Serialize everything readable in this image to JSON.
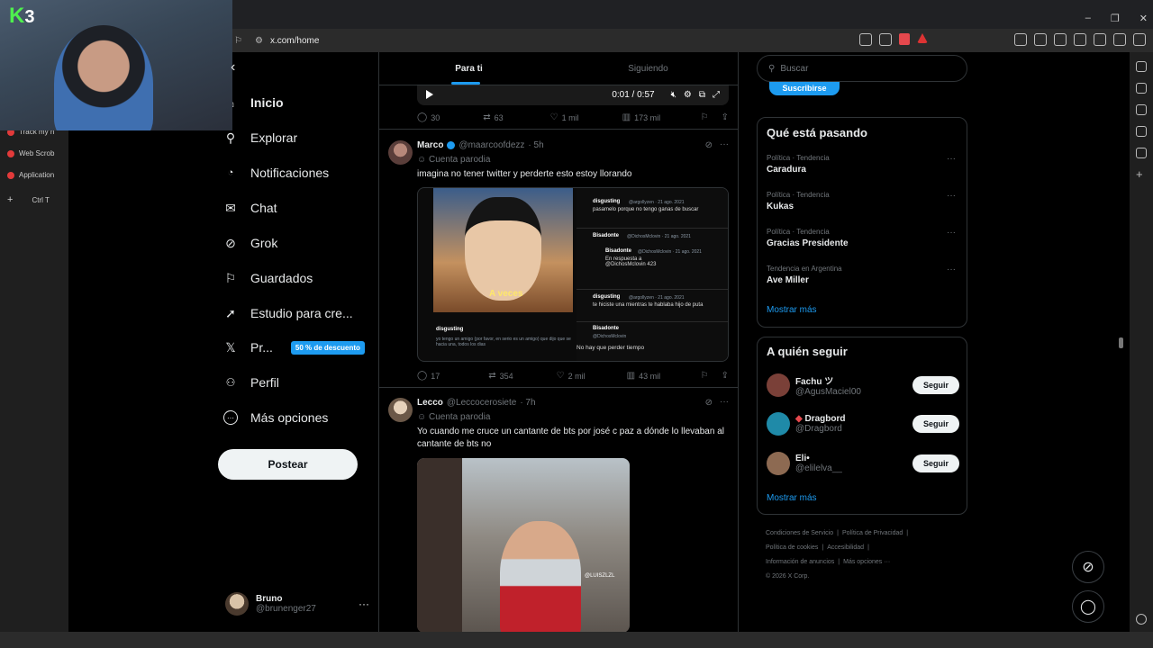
{
  "browser": {
    "url": "x.com/home",
    "window_controls": [
      "–",
      "❐",
      "✕"
    ],
    "sidebar_tabs": [
      "Track my n",
      "Web Scrob",
      "Application"
    ],
    "sidebar_new": "+",
    "sidebar_shortcut": "Ctrl   T"
  },
  "webcam": {
    "logo_letter": "K",
    "logo_number": "3"
  },
  "nav": {
    "items": [
      {
        "label": "Inicio",
        "icon": "home-icon",
        "glyph": "⌂"
      },
      {
        "label": "Explorar",
        "icon": "search-icon",
        "glyph": "⚲"
      },
      {
        "label": "Notificaciones",
        "icon": "bell-icon",
        "glyph": "🔔"
      },
      {
        "label": "Chat",
        "icon": "mail-icon",
        "glyph": "✉"
      },
      {
        "label": "Grok",
        "icon": "grok-icon",
        "glyph": "⊘"
      },
      {
        "label": "Guardados",
        "icon": "bookmark-icon",
        "glyph": "⚐"
      },
      {
        "label": "Estudio para cre...",
        "icon": "rocket-icon",
        "glyph": "➚"
      },
      {
        "label": "Pr...",
        "icon": "x-logo-icon",
        "glyph": "𝕏",
        "badge": "50 % de descuento"
      },
      {
        "label": "Perfil",
        "icon": "user-icon",
        "glyph": "👤"
      },
      {
        "label": "Más opciones",
        "icon": "more-circle-icon",
        "glyph": "⋯"
      }
    ],
    "post_label": "Postear"
  },
  "account": {
    "name": "Bruno",
    "handle": "@brunenger27",
    "more": "···"
  },
  "feed": {
    "tabs": [
      "Para ti",
      "Siguiendo"
    ],
    "video_bar": {
      "time": "0:01 / 0:57"
    },
    "first_actions": {
      "replies": "30",
      "reposts": "63",
      "likes": "1 mil",
      "views": "173 mil"
    },
    "tweets": [
      {
        "name": "Marco",
        "handle": "@maarcoofdezz",
        "time": "· 5h",
        "parody": "Cuenta parodia",
        "text": "imagina no tener twitter y perderte esto estoy llorando",
        "media": {
          "caption": "A veces",
          "thread": [
            {
              "user": "disgusting",
              "meta": "@argollyzen · 21 ago. 2021",
              "text": "pasamelo porque no tengo ganas de buscar"
            },
            {
              "user": "Bisadonte",
              "meta": "@DichosMclovin · 21 ago. 2021",
              "text": ""
            },
            {
              "user": "Bisadonte",
              "meta": "@DichosMclovin · 21 ago. 2021",
              "text": "En respuesta a @DichosMclovin 423"
            },
            {
              "user": "disgusting",
              "meta": "@argollyzen · 21 ago. 2021",
              "text": "te hiciste una mientras te hablaba hijo de puta"
            },
            {
              "user": "Bisadonte",
              "meta": "@DichosMclovin",
              "text": "No hay que perder tiempo"
            },
            {
              "user": "disgusting",
              "meta": "@argollyzen · 21 ago. 2021",
              "text": "yo tengo un amigo (por favor, en serio es un amigo) que dijo que se hacia una, todos los dias"
            }
          ]
        },
        "actions": {
          "replies": "17",
          "reposts": "354",
          "likes": "2 mil",
          "views": "43 mil"
        }
      },
      {
        "name": "Lecco",
        "handle": "@Leccocerosiete",
        "time": "· 7h",
        "parody": "Cuenta parodia",
        "text": "Yo cuando me cruce un cantante de bts por josé c paz a dónde lo llevaban al cantante de bts no",
        "media": {
          "tag": "@LUISZLZL"
        }
      }
    ]
  },
  "right": {
    "search_placeholder": "Buscar",
    "subscribe": "Suscribirse",
    "trending_title": "Qué está pasando",
    "trends": [
      {
        "meta": "Política · Tendencia",
        "name": "Caradura"
      },
      {
        "meta": "Política · Tendencia",
        "name": "Kukas"
      },
      {
        "meta": "Política · Tendencia",
        "name": "Gracias Presidente"
      },
      {
        "meta": "Tendencia en Argentina",
        "name": "Ave Miller"
      }
    ],
    "show_more": "Mostrar más",
    "follow_title": "A quién seguir",
    "follow": [
      {
        "name": "Fachu ツ",
        "handle": "@AgusMaciel00",
        "button": "Seguir",
        "color": "#7a4038"
      },
      {
        "name": "Dragbord",
        "handle": "@Dragbord",
        "button": "Seguir",
        "color": "#1f8aa8"
      },
      {
        "name": "Eli•",
        "handle": "@elilelva__",
        "button": "Seguir",
        "color": "#8d6a52"
      }
    ],
    "footer": [
      "Condiciones de Servicio",
      "|",
      "Política de Privacidad",
      "|",
      "Política de cookies",
      "|",
      "Accesibilidad",
      "|",
      "Información de anuncios",
      "|",
      "Más opciones ···",
      "© 2026 X Corp."
    ]
  },
  "colors": {
    "accent": "#1d9bf0",
    "bg": "#000000",
    "border": "#2f3336",
    "muted": "#71767b"
  }
}
